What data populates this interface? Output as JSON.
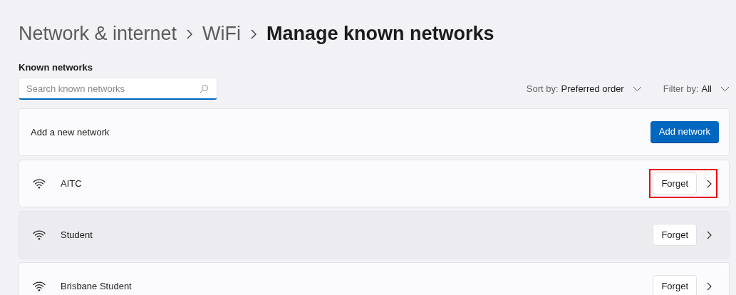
{
  "breadcrumb": [
    {
      "label": "Network & internet",
      "current": false
    },
    {
      "label": "WiFi",
      "current": false
    },
    {
      "label": "Manage known networks",
      "current": true
    }
  ],
  "section_title": "Known networks",
  "search": {
    "placeholder": "Search known networks"
  },
  "sort": {
    "label": "Sort by:",
    "value": "Preferred order"
  },
  "filter": {
    "label": "Filter by:",
    "value": "All"
  },
  "add_card": {
    "label": "Add a new network",
    "button": "Add network"
  },
  "networks": [
    {
      "name": "AITC",
      "button": "Forget",
      "hovered": false,
      "highlighted": true
    },
    {
      "name": "Student",
      "button": "Forget",
      "hovered": true,
      "highlighted": false
    },
    {
      "name": "Brisbane Student",
      "button": "Forget",
      "hovered": false,
      "highlighted": false
    }
  ]
}
